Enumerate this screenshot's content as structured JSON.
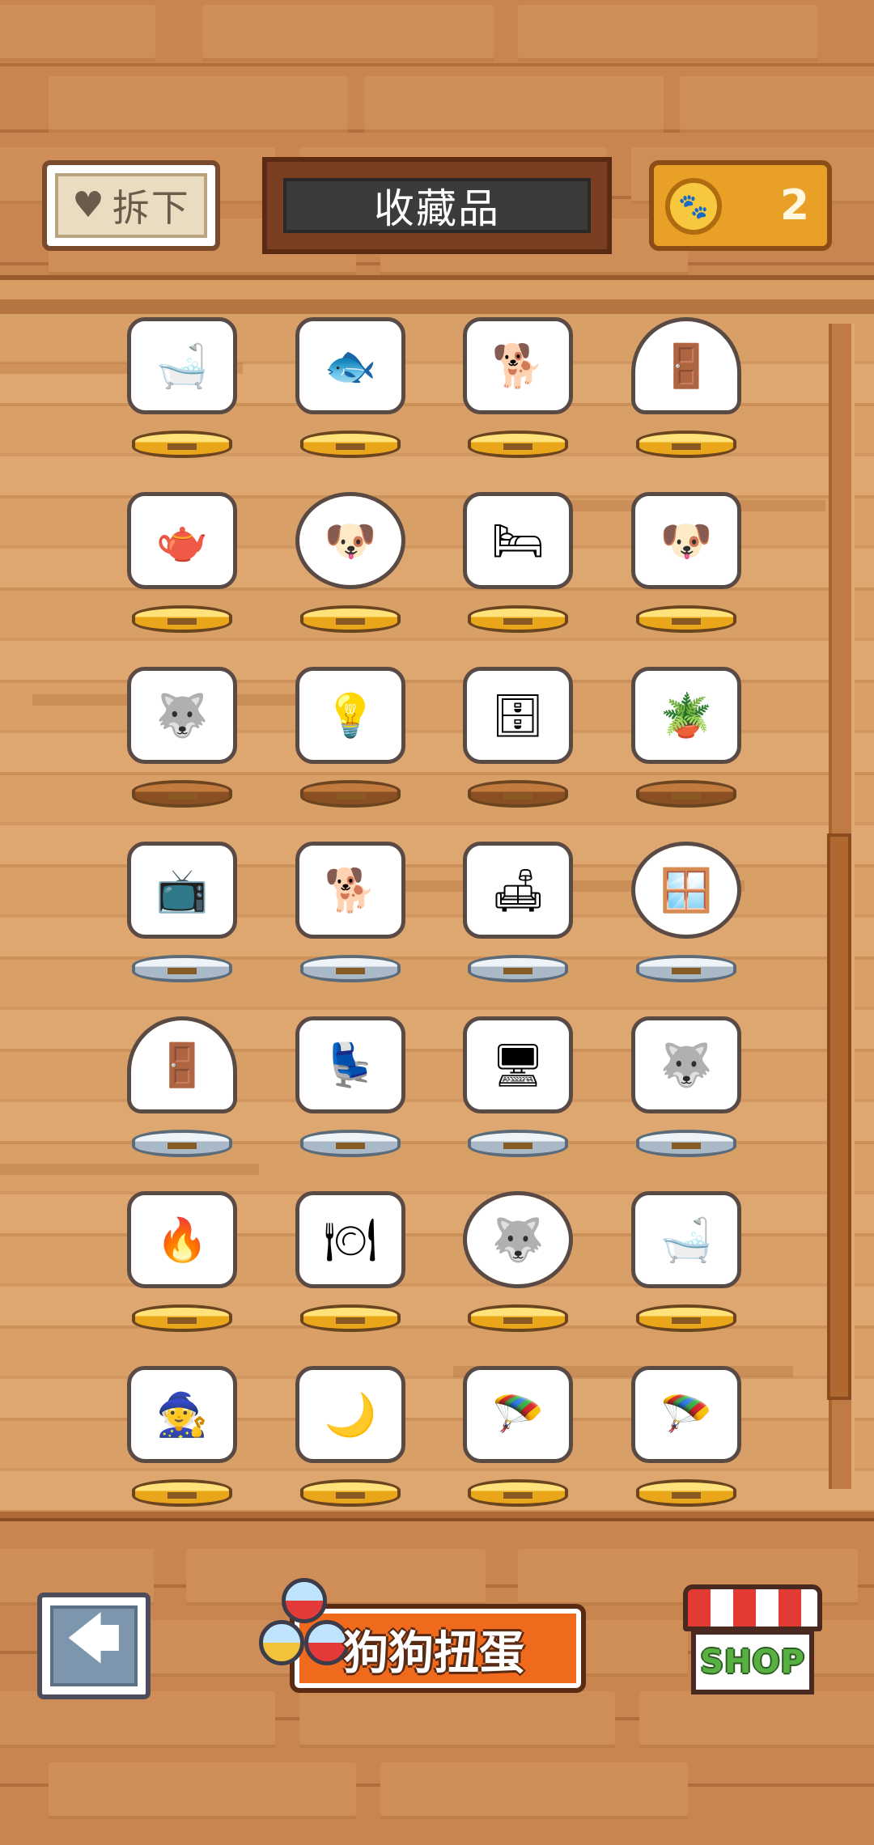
{
  "header": {
    "unmount_label": "拆下",
    "title": "收藏品",
    "coin_count": "2"
  },
  "collection": {
    "rows": [
      [
        {
          "icon": "bathtub-dog",
          "base": "gold",
          "glyph": "🛁"
        },
        {
          "icon": "fishbowl-dog",
          "base": "gold",
          "glyph": "🐟"
        },
        {
          "icon": "dining-dog",
          "base": "gold",
          "glyph": "🐕"
        },
        {
          "icon": "door-dome-dog",
          "base": "gold",
          "glyph": "🚪",
          "shape": "dome"
        }
      ],
      [
        {
          "icon": "tea-cart-dog",
          "base": "gold",
          "glyph": "🫖"
        },
        {
          "icon": "capsule-dog-red",
          "base": "gold",
          "glyph": "🐶",
          "shape": "globe"
        },
        {
          "icon": "bed-dog",
          "base": "gold",
          "glyph": "🛏"
        },
        {
          "icon": "ball-pool-dog",
          "base": "gold",
          "glyph": "🐶"
        }
      ],
      [
        {
          "icon": "husky-sitting",
          "base": "bronze",
          "glyph": "🐺"
        },
        {
          "icon": "lamp-dog",
          "base": "bronze",
          "glyph": "💡"
        },
        {
          "icon": "wardrobe-dog",
          "base": "bronze",
          "glyph": "🗄"
        },
        {
          "icon": "plant-table-dog",
          "base": "bronze",
          "glyph": "🪴"
        }
      ],
      [
        {
          "icon": "tv-husky",
          "base": "silver",
          "glyph": "📺"
        },
        {
          "icon": "two-dogs",
          "base": "silver",
          "glyph": "🐕"
        },
        {
          "icon": "sofa-dogs",
          "base": "silver",
          "glyph": "🛋"
        },
        {
          "icon": "window-dogs",
          "base": "silver",
          "glyph": "🪟",
          "shape": "globe"
        }
      ],
      [
        {
          "icon": "door-dome-husky",
          "base": "silver",
          "glyph": "🚪",
          "shape": "dome"
        },
        {
          "icon": "armchair-husky",
          "base": "silver",
          "glyph": "💺"
        },
        {
          "icon": "computer-husky",
          "base": "silver",
          "glyph": "🖥"
        },
        {
          "icon": "cushion-husky",
          "base": "silver",
          "glyph": "🐺"
        }
      ],
      [
        {
          "icon": "fireplace-dogs",
          "base": "gold",
          "glyph": "🔥"
        },
        {
          "icon": "dining-dogs",
          "base": "gold",
          "glyph": "🍽"
        },
        {
          "icon": "capsule-husky-blue",
          "base": "gold",
          "glyph": "🐺",
          "shape": "globe"
        },
        {
          "icon": "bathtub-dogs",
          "base": "gold",
          "glyph": "🛁"
        }
      ],
      [
        {
          "icon": "wizard-husky",
          "base": "gold",
          "glyph": "🧙"
        },
        {
          "icon": "moon-husky",
          "base": "gold",
          "glyph": "🌙"
        },
        {
          "icon": "parachute-dog",
          "base": "gold",
          "glyph": "🪂"
        },
        {
          "icon": "parachute-husky",
          "base": "gold",
          "glyph": "🪂"
        }
      ]
    ]
  },
  "footer": {
    "back_icon": "arrow-left-icon",
    "gacha_label": "狗狗扭蛋",
    "shop_label": "SHOP"
  }
}
